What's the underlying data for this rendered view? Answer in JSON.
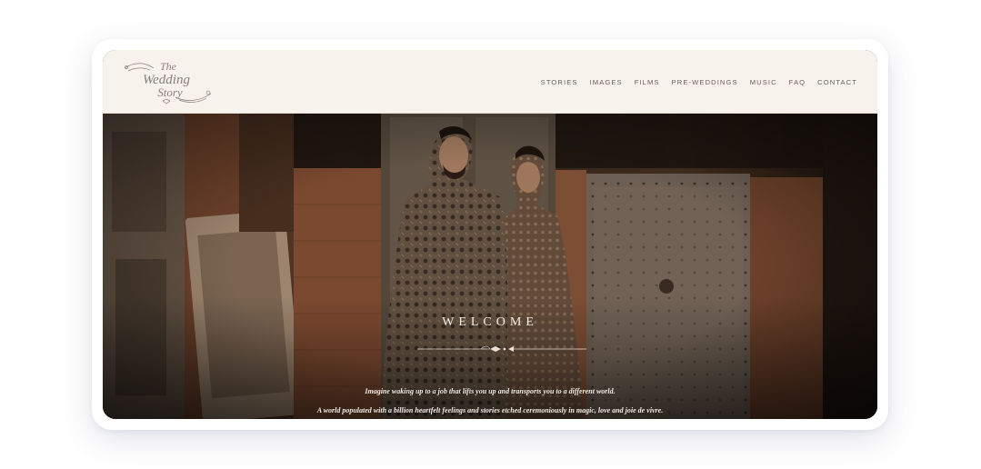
{
  "logo": {
    "line1": "The",
    "line2": "Wedding",
    "line3": "Story"
  },
  "nav": {
    "items": [
      {
        "label": "STORIES"
      },
      {
        "label": "IMAGES"
      },
      {
        "label": "FILMS"
      },
      {
        "label": "PRE-WEDDINGS"
      },
      {
        "label": "MUSIC"
      },
      {
        "label": "FAQ"
      },
      {
        "label": "CONTACT"
      }
    ]
  },
  "hero": {
    "title": "WELCOME",
    "tagline_1": "Imagine waking up to a job that lifts you up and transports you to a different world.",
    "tagline_2": "A world populated with a billion heartfelt feelings and stories etched ceremoniously in magic, love and joie de vivre."
  },
  "colors": {
    "header_bg": "#f7f2ec",
    "nav_text": "#6a5f57",
    "logo": "#8a8079",
    "hero_text": "#f4ede5"
  },
  "icons": {
    "logo": "the-wedding-story-logo",
    "divider": "ornamental-divider-icon"
  }
}
